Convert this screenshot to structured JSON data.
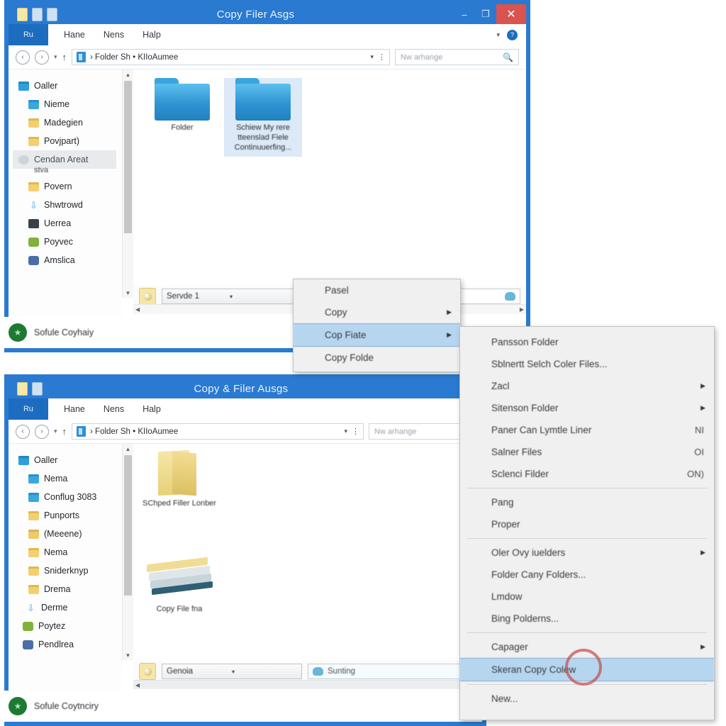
{
  "window_top": {
    "title": "Copy Filer Asgs",
    "title_icons": [
      "file-icon",
      "lock-icon",
      "lock-icon"
    ],
    "caption_buttons": {
      "minimize": "–",
      "maximize": "❐",
      "close": "✕"
    },
    "ribbon": {
      "file_label": "Ru",
      "tabs": [
        "Hane",
        "Nens",
        "Halp"
      ],
      "caret": "▾",
      "help_label": "?"
    },
    "address": {
      "back": "‹",
      "forward": "›",
      "recent": "▾",
      "up": "↑",
      "path": "› Folder Sh • KIIoAumee",
      "dropdown_caret": "▾",
      "refresh": "⋮"
    },
    "search": {
      "placeholder": "Nw arhange",
      "icon": "search-icon"
    },
    "sidebar": [
      {
        "label": "Oaller",
        "icon": "folder-blue-icon"
      },
      {
        "label": "Nieme",
        "icon": "folder-blue-icon"
      },
      {
        "label": "Madegien",
        "icon": "folder-yellow-icon"
      },
      {
        "label": "Povjpart)",
        "icon": "folder-yellow-icon"
      },
      {
        "label": "Cendan Areat",
        "icon": "grey-disc-icon",
        "selected": true,
        "sub": "stva"
      },
      {
        "label": "Povern",
        "icon": "folder-yellow-icon"
      },
      {
        "label": "Shwtrowd",
        "icon": "download-icon"
      },
      {
        "label": "Uerrea",
        "icon": "dark-square-icon"
      },
      {
        "label": "Poyvec",
        "icon": "network-icon"
      },
      {
        "label": "Amslica",
        "icon": "person-icon"
      }
    ],
    "tiles": [
      {
        "label": "Folder",
        "icon": "folder-blue-icon",
        "selected": false
      },
      {
        "label": "Schiew My rere tteenslad Fiele Continuuerfing...",
        "icon": "folder-blue-icon",
        "selected": true
      }
    ],
    "status": {
      "combo_value": "Servde 1",
      "combo_caret": "▾",
      "field_value": ""
    },
    "bottom": {
      "icon": "green-shield-icon",
      "text": "Sofule Coyhaiy"
    }
  },
  "window_bottom": {
    "title": "Copy & Filer Ausgs",
    "title_icons": [
      "file-icon",
      "lock-icon"
    ],
    "ribbon": {
      "file_label": "Ru",
      "tabs": [
        "Hane",
        "Nens",
        "Halp"
      ]
    },
    "address": {
      "back": "‹",
      "forward": "›",
      "recent": "▾",
      "up": "↑",
      "path": "› Folder Sh • KIIoAumee",
      "dropdown_caret": "▾",
      "refresh": "⋮"
    },
    "search": {
      "placeholder": "Nw arhange",
      "icon": "search-icon"
    },
    "sidebar": [
      {
        "label": "Oaller",
        "icon": "folder-blue-icon"
      },
      {
        "label": "Nema",
        "icon": "folder-blue-icon"
      },
      {
        "label": "Conflug 3083",
        "icon": "folder-blue-icon"
      },
      {
        "label": "Punports",
        "icon": "folder-yellow-icon"
      },
      {
        "label": "(Meeene)",
        "icon": "folder-yellow-icon"
      },
      {
        "label": "Nema",
        "icon": "folder-yellow-icon"
      },
      {
        "label": "Sniderknyp",
        "icon": "folder-yellow-icon"
      },
      {
        "label": "Drema",
        "icon": "folder-yellow-icon"
      },
      {
        "label": "Derme",
        "icon": "download-icon"
      },
      {
        "label": "Poytez",
        "icon": "network-icon"
      },
      {
        "label": "Pendlrea",
        "icon": "person-icon"
      }
    ],
    "tiles": [
      {
        "label": "SChped Filler Lonber",
        "icon": "folder-yellow-open-icon"
      },
      {
        "label": "Copy File fna",
        "icon": "paper-stack-icon"
      }
    ],
    "status": {
      "combo_value": "Genoia",
      "combo_caret": "▾",
      "field_icon": "cloud-icon",
      "field_value": "Sunting"
    },
    "bottom": {
      "icon": "green-shield-icon",
      "text": "Sofule Coytnciry"
    }
  },
  "context_menu_primary": {
    "items": [
      {
        "label": "Pasel",
        "submenu": false,
        "highlighted": false
      },
      {
        "label": "Copy",
        "submenu": true,
        "highlighted": false
      },
      {
        "label": "Cop Fiate",
        "submenu": true,
        "highlighted": true
      },
      {
        "label": "Copy Folde",
        "submenu": false,
        "highlighted": false
      }
    ]
  },
  "context_menu_submenu": {
    "items": [
      {
        "label": "Pansson Folder",
        "accel": "",
        "submenu": false,
        "separator_after": false
      },
      {
        "label": "Sblnertt Selch Coler Files...",
        "accel": "",
        "submenu": false,
        "separator_after": false
      },
      {
        "label": "Zacl",
        "accel": "",
        "submenu": true,
        "separator_after": false
      },
      {
        "label": "Sitenson Folder",
        "accel": "",
        "submenu": true,
        "separator_after": false
      },
      {
        "label": "Paner Can Lymtle Liner",
        "accel": "NI",
        "submenu": false,
        "separator_after": false
      },
      {
        "label": "Salner Files",
        "accel": "OI",
        "submenu": false,
        "separator_after": false
      },
      {
        "label": "Sclenci Filder",
        "accel": "ON)",
        "submenu": false,
        "separator_after": true
      },
      {
        "label": "Pang",
        "accel": "",
        "submenu": false,
        "separator_after": false
      },
      {
        "label": "Proper",
        "accel": "",
        "submenu": false,
        "separator_after": true
      },
      {
        "label": "Oler Ovy iuelders",
        "accel": "",
        "submenu": true,
        "separator_after": false
      },
      {
        "label": "Folder Cany Folders...",
        "accel": "",
        "submenu": false,
        "separator_after": false
      },
      {
        "label": "Lmdow",
        "accel": "",
        "submenu": false,
        "separator_after": false
      },
      {
        "label": "Bing Polderns...",
        "accel": "",
        "submenu": false,
        "separator_after": true
      },
      {
        "label": "Capager",
        "accel": "",
        "submenu": true,
        "separator_after": false
      },
      {
        "label": "Skeran Copy Colew",
        "accel": "",
        "submenu": false,
        "highlighted": true,
        "separator_after": true
      },
      {
        "label": "New...",
        "accel": "",
        "submenu": false,
        "separator_after": false
      }
    ]
  },
  "annotation": {
    "shape": "ellipse",
    "color": "#c0504d",
    "target": "Skeran Copy Colew"
  },
  "colors": {
    "window_frame": "#2a7ad2",
    "titlebar": "#2a7ad2",
    "close_button": "#d9534f",
    "menu_bg": "#f0f0f0",
    "menu_highlight": "#b6d6f0",
    "annotation": "#c0504d",
    "selection": "#dce9f7"
  }
}
